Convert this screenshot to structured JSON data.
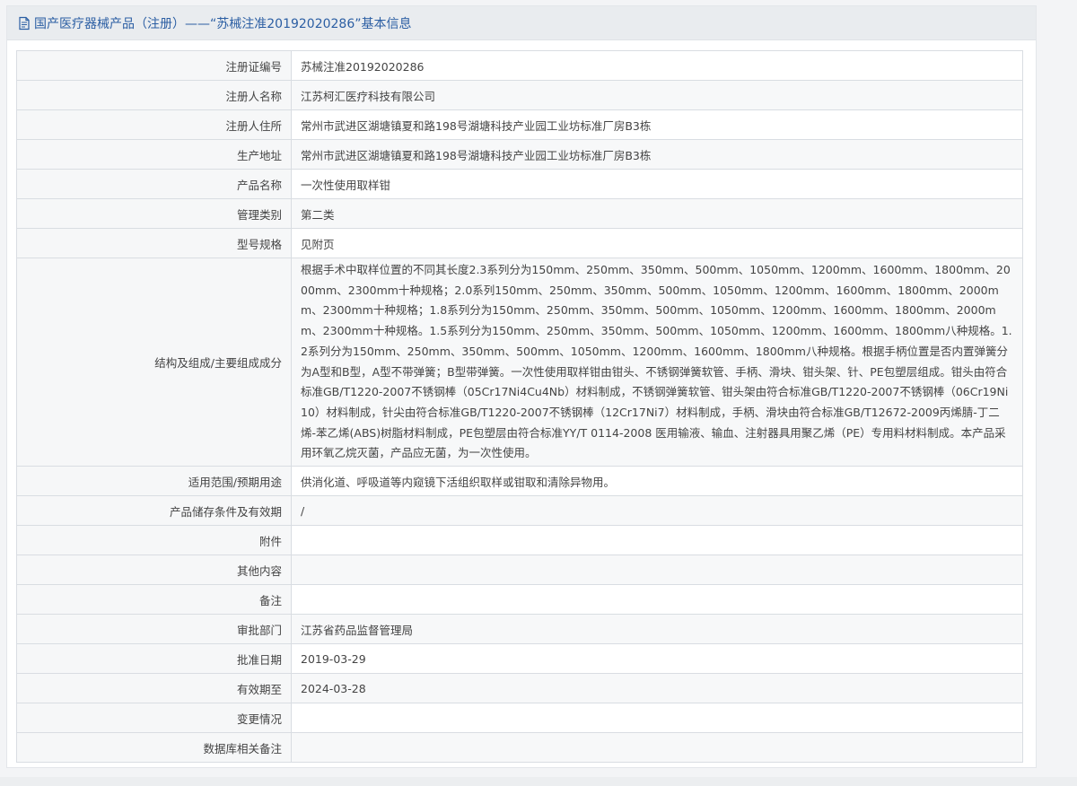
{
  "header": {
    "icon": "document-icon",
    "title": "国产医疗器械产品（注册）——“苏械注准20192020286”基本信息"
  },
  "rows": [
    {
      "label": "注册证编号",
      "value": "苏械注准20192020286"
    },
    {
      "label": "注册人名称",
      "value": "江苏柯汇医疗科技有限公司"
    },
    {
      "label": "注册人住所",
      "value": "常州市武进区湖塘镇夏和路198号湖塘科技产业园工业坊标准厂房B3栋"
    },
    {
      "label": "生产地址",
      "value": "常州市武进区湖塘镇夏和路198号湖塘科技产业园工业坊标准厂房B3栋"
    },
    {
      "label": "产品名称",
      "value": "一次性使用取样钳"
    },
    {
      "label": "管理类别",
      "value": "第二类"
    },
    {
      "label": "型号规格",
      "value": "见附页"
    },
    {
      "label": "结构及组成/主要组成成分",
      "value": "根据手术中取样位置的不同其长度2.3系列分为150mm、250mm、350mm、500mm、1050mm、1200mm、1600mm、1800mm、2000mm、2300mm十种规格；2.0系列150mm、250mm、350mm、500mm、1050mm、1200mm、1600mm、1800mm、2000mm、2300mm十种规格；1.8系列分为150mm、250mm、350mm、500mm、1050mm、1200mm、1600mm、1800mm、2000mm、2300mm十种规格。1.5系列分为150mm、250mm、350mm、500mm、1050mm、1200mm、1600mm、1800mm八种规格。1.2系列分为150mm、250mm、350mm、500mm、1050mm、1200mm、1600mm、1800mm八种规格。根据手柄位置是否内置弹簧分为A型和B型，A型不带弹簧；B型带弹簧。一次性使用取样钳由钳头、不锈钢弹簧软管、手柄、滑块、钳头架、针、PE包塑层组成。钳头由符合标准GB/T1220-2007不锈钢棒（05Cr17Ni4Cu4Nb）材料制成，不锈钢弹簧软管、钳头架由符合标准GB/T1220-2007不锈钢棒（06Cr19Ni10）材料制成，针尖由符合标准GB/T1220-2007不锈钢棒（12Cr17Ni7）材料制成，手柄、滑块由符合标准GB/T12672-2009丙烯腈-丁二烯-苯乙烯(ABS)树脂材料制成，PE包塑层由符合标准YY/T 0114-2008 医用输液、输血、注射器具用聚乙烯（PE）专用料材料制成。本产品采用环氧乙烷灭菌，产品应无菌，为一次性使用。"
    },
    {
      "label": "适用范围/预期用途",
      "value": "供消化道、呼吸道等内窥镜下活组织取样或钳取和清除异物用。"
    },
    {
      "label": "产品储存条件及有效期",
      "value": "/"
    },
    {
      "label": "附件",
      "value": ""
    },
    {
      "label": "其他内容",
      "value": ""
    },
    {
      "label": "备注",
      "value": ""
    },
    {
      "label": "审批部门",
      "value": "江苏省药品监督管理局"
    },
    {
      "label": "批准日期",
      "value": "2019-03-29"
    },
    {
      "label": "有效期至",
      "value": "2024-03-28"
    },
    {
      "label": "变更情况",
      "value": ""
    },
    {
      "label": "数据库相关备注",
      "value": ""
    }
  ]
}
